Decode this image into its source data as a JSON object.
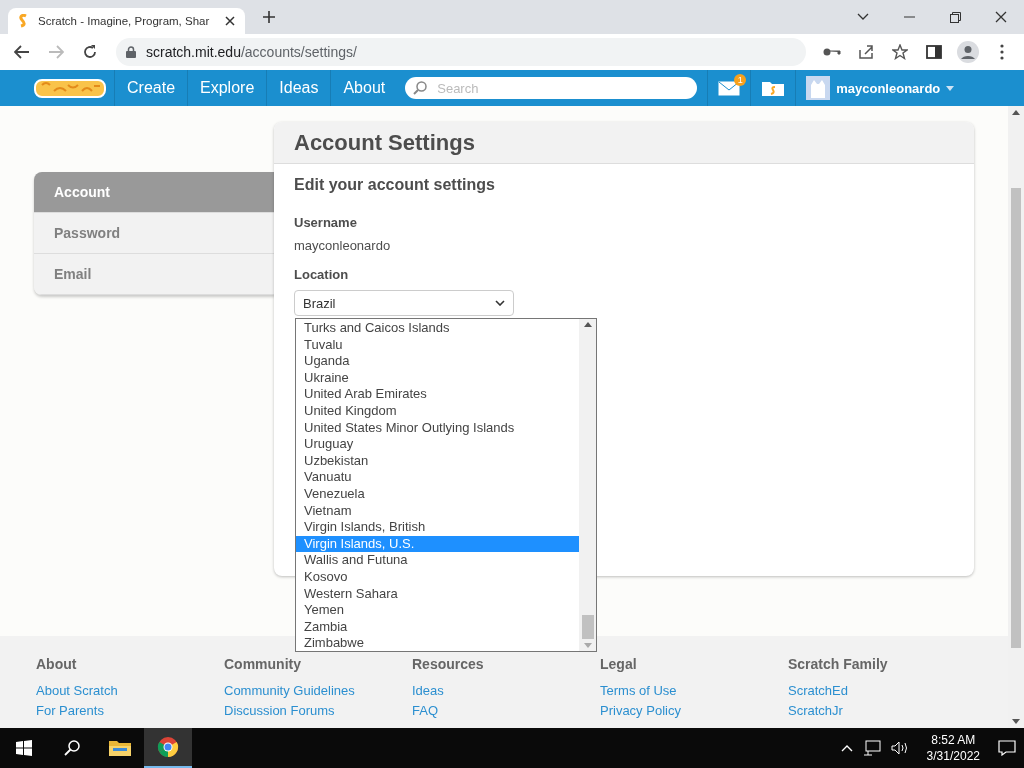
{
  "browser": {
    "tab_title": "Scratch - Imagine, Program, Shar",
    "url_host": "scratch.mit.edu",
    "url_path": "/accounts/settings/"
  },
  "nav": {
    "items": [
      "Create",
      "Explore",
      "Ideas",
      "About"
    ],
    "search": {
      "placeholder": "Search"
    },
    "message_count": "1",
    "username": "mayconleonardo"
  },
  "sidebar": {
    "items": [
      {
        "label": "Account",
        "selected": true
      },
      {
        "label": "Password",
        "selected": false
      },
      {
        "label": "Email",
        "selected": false
      }
    ]
  },
  "settings": {
    "title": "Account Settings",
    "subtitle": "Edit your account settings",
    "username_label": "Username",
    "username": "mayconleonardo",
    "location_label": "Location",
    "location": "Brazil",
    "options": [
      {
        "label": "Turks and Caicos Islands",
        "selected": false
      },
      {
        "label": "Tuvalu",
        "selected": false
      },
      {
        "label": "Uganda",
        "selected": false
      },
      {
        "label": "Ukraine",
        "selected": false
      },
      {
        "label": "United Arab Emirates",
        "selected": false
      },
      {
        "label": "United Kingdom",
        "selected": false
      },
      {
        "label": "United States Minor Outlying Islands",
        "selected": false
      },
      {
        "label": "Uruguay",
        "selected": false
      },
      {
        "label": "Uzbekistan",
        "selected": false
      },
      {
        "label": "Vanuatu",
        "selected": false
      },
      {
        "label": "Venezuela",
        "selected": false
      },
      {
        "label": "Vietnam",
        "selected": false
      },
      {
        "label": "Virgin Islands, British",
        "selected": false
      },
      {
        "label": "Virgin Islands, U.S.",
        "selected": true
      },
      {
        "label": "Wallis and Futuna",
        "selected": false
      },
      {
        "label": "Kosovo",
        "selected": false
      },
      {
        "label": "Western Sahara",
        "selected": false
      },
      {
        "label": "Yemen",
        "selected": false
      },
      {
        "label": "Zambia",
        "selected": false
      },
      {
        "label": "Zimbabwe",
        "selected": false
      }
    ]
  },
  "footer": {
    "columns": [
      {
        "heading": "About",
        "links": [
          "About Scratch",
          "For Parents"
        ]
      },
      {
        "heading": "Community",
        "links": [
          "Community Guidelines",
          "Discussion Forums"
        ]
      },
      {
        "heading": "Resources",
        "links": [
          "Ideas",
          "FAQ"
        ]
      },
      {
        "heading": "Legal",
        "links": [
          "Terms of Use",
          "Privacy Policy"
        ]
      },
      {
        "heading": "Scratch Family",
        "links": [
          "ScratchEd",
          "ScratchJr"
        ]
      }
    ]
  },
  "taskbar": {
    "time": "8:52 AM",
    "date": "3/31/2022"
  }
}
